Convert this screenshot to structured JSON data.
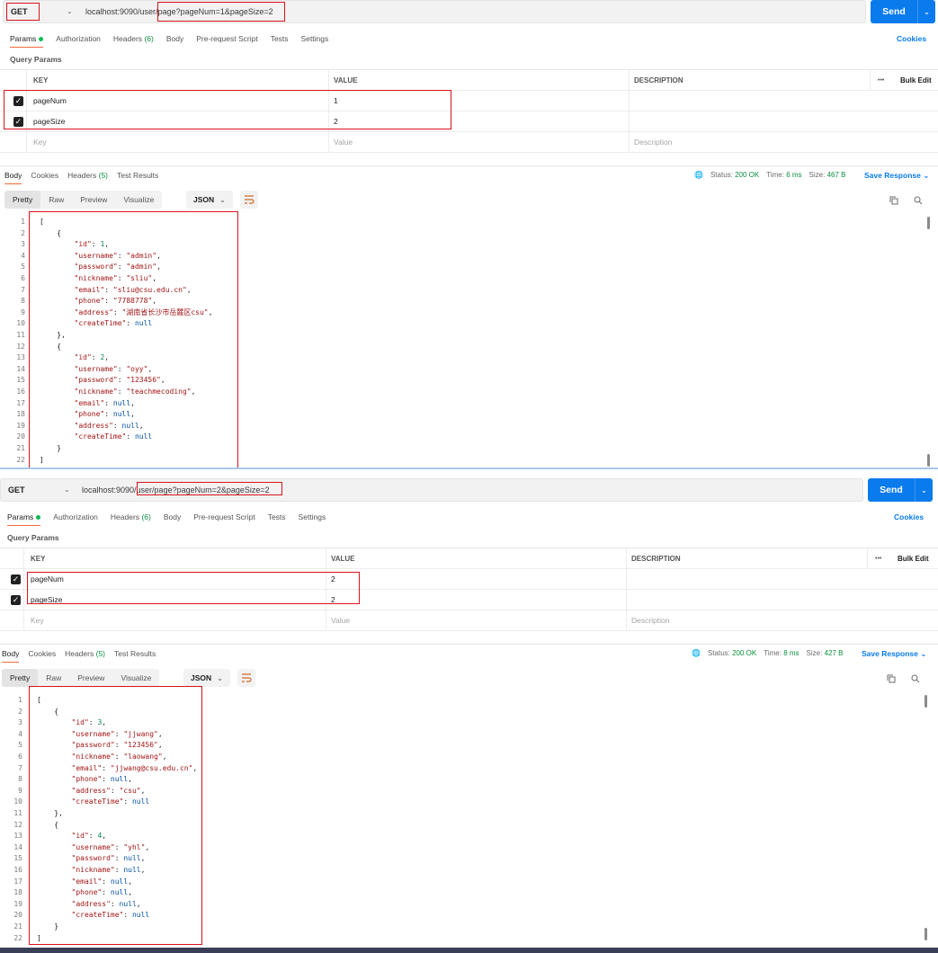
{
  "panels": [
    {
      "request": {
        "method": "GET",
        "url_prefix": "localhost:9090/user/",
        "url_suffix": "page?pageNum=1&pageSize=2",
        "send_label": "Send"
      },
      "tabs": {
        "params": "Params",
        "authorization": "Authorization",
        "headers": "Headers",
        "headers_count": "(6)",
        "body": "Body",
        "prerequest": "Pre-request Script",
        "tests": "Tests",
        "settings": "Settings",
        "cookies": "Cookies"
      },
      "query_params_label": "Query Params",
      "table": {
        "col_key": "KEY",
        "col_value": "VALUE",
        "col_description": "DESCRIPTION",
        "more": "•••",
        "bulk_edit": "Bulk Edit",
        "rows": [
          {
            "key": "pageNum",
            "value": "1"
          },
          {
            "key": "pageSize",
            "value": "2"
          }
        ],
        "placeholder_key": "Key",
        "placeholder_value": "Value",
        "placeholder_description": "Description"
      },
      "response": {
        "tabs": {
          "body": "Body",
          "cookies": "Cookies",
          "headers": "Headers",
          "headers_count": "(5)",
          "test_results": "Test Results"
        },
        "status_label": "Status:",
        "status_value": "200 OK",
        "time_label": "Time:",
        "time_value": "6 ms",
        "size_label": "Size:",
        "size_value": "467 B",
        "save_response": "Save Response",
        "formats": {
          "pretty": "Pretty",
          "raw": "Raw",
          "preview": "Preview",
          "visualize": "Visualize"
        },
        "json_label": "JSON"
      },
      "code_lines": [
        [
          [
            "p",
            "["
          ]
        ],
        [
          [
            "p",
            "    {"
          ]
        ],
        [
          [
            "p",
            "        "
          ],
          [
            "k",
            "\"id\""
          ],
          [
            "p",
            ": "
          ],
          [
            "n",
            "1"
          ],
          [
            "p",
            ","
          ]
        ],
        [
          [
            "p",
            "        "
          ],
          [
            "k",
            "\"username\""
          ],
          [
            "p",
            ": "
          ],
          [
            "s",
            "\"admin\""
          ],
          [
            "p",
            ","
          ]
        ],
        [
          [
            "p",
            "        "
          ],
          [
            "k",
            "\"password\""
          ],
          [
            "p",
            ": "
          ],
          [
            "s",
            "\"admin\""
          ],
          [
            "p",
            ","
          ]
        ],
        [
          [
            "p",
            "        "
          ],
          [
            "k",
            "\"nickname\""
          ],
          [
            "p",
            ": "
          ],
          [
            "s",
            "\"sliu\""
          ],
          [
            "p",
            ","
          ]
        ],
        [
          [
            "p",
            "        "
          ],
          [
            "k",
            "\"email\""
          ],
          [
            "p",
            ": "
          ],
          [
            "s",
            "\"sliu@csu.edu.cn\""
          ],
          [
            "p",
            ","
          ]
        ],
        [
          [
            "p",
            "        "
          ],
          [
            "k",
            "\"phone\""
          ],
          [
            "p",
            ": "
          ],
          [
            "s",
            "\"7788778\""
          ],
          [
            "p",
            ","
          ]
        ],
        [
          [
            "p",
            "        "
          ],
          [
            "k",
            "\"address\""
          ],
          [
            "p",
            ": "
          ],
          [
            "s",
            "\"湖南省长沙市岳麓区csu\""
          ],
          [
            "p",
            ","
          ]
        ],
        [
          [
            "p",
            "        "
          ],
          [
            "k",
            "\"createTime\""
          ],
          [
            "p",
            ": "
          ],
          [
            "nl",
            "null"
          ]
        ],
        [
          [
            "p",
            "    },"
          ]
        ],
        [
          [
            "p",
            "    {"
          ]
        ],
        [
          [
            "p",
            "        "
          ],
          [
            "k",
            "\"id\""
          ],
          [
            "p",
            ": "
          ],
          [
            "n",
            "2"
          ],
          [
            "p",
            ","
          ]
        ],
        [
          [
            "p",
            "        "
          ],
          [
            "k",
            "\"username\""
          ],
          [
            "p",
            ": "
          ],
          [
            "s",
            "\"oyy\""
          ],
          [
            "p",
            ","
          ]
        ],
        [
          [
            "p",
            "        "
          ],
          [
            "k",
            "\"password\""
          ],
          [
            "p",
            ": "
          ],
          [
            "s",
            "\"123456\""
          ],
          [
            "p",
            ","
          ]
        ],
        [
          [
            "p",
            "        "
          ],
          [
            "k",
            "\"nickname\""
          ],
          [
            "p",
            ": "
          ],
          [
            "s",
            "\"teachmecoding\""
          ],
          [
            "p",
            ","
          ]
        ],
        [
          [
            "p",
            "        "
          ],
          [
            "k",
            "\"email\""
          ],
          [
            "p",
            ": "
          ],
          [
            "nl",
            "null"
          ],
          [
            "p",
            ","
          ]
        ],
        [
          [
            "p",
            "        "
          ],
          [
            "k",
            "\"phone\""
          ],
          [
            "p",
            ": "
          ],
          [
            "nl",
            "null"
          ],
          [
            "p",
            ","
          ]
        ],
        [
          [
            "p",
            "        "
          ],
          [
            "k",
            "\"address\""
          ],
          [
            "p",
            ": "
          ],
          [
            "nl",
            "null"
          ],
          [
            "p",
            ","
          ]
        ],
        [
          [
            "p",
            "        "
          ],
          [
            "k",
            "\"createTime\""
          ],
          [
            "p",
            ": "
          ],
          [
            "nl",
            "null"
          ]
        ],
        [
          [
            "p",
            "    }"
          ]
        ],
        [
          [
            "p",
            "]"
          ]
        ]
      ]
    },
    {
      "request": {
        "method": "GET",
        "url_prefix": "localhost:9090/",
        "url_suffix": "user/page?pageNum=2&pageSize=2",
        "send_label": "Send"
      },
      "tabs": {
        "params": "Params",
        "authorization": "Authorization",
        "headers": "Headers",
        "headers_count": "(6)",
        "body": "Body",
        "prerequest": "Pre-request Script",
        "tests": "Tests",
        "settings": "Settings",
        "cookies": "Cookies"
      },
      "query_params_label": "Query Params",
      "table": {
        "col_key": "KEY",
        "col_value": "VALUE",
        "col_description": "DESCRIPTION",
        "more": "•••",
        "bulk_edit": "Bulk Edit",
        "rows": [
          {
            "key": "pageNum",
            "value": "2"
          },
          {
            "key": "pageSize",
            "value": "2"
          }
        ],
        "placeholder_key": "Key",
        "placeholder_value": "Value",
        "placeholder_description": "Description"
      },
      "response": {
        "tabs": {
          "body": "Body",
          "cookies": "Cookies",
          "headers": "Headers",
          "headers_count": "(5)",
          "test_results": "Test Results"
        },
        "status_label": "Status:",
        "status_value": "200 OK",
        "time_label": "Time:",
        "time_value": "8 ms",
        "size_label": "Size:",
        "size_value": "427 B",
        "save_response": "Save Response",
        "formats": {
          "pretty": "Pretty",
          "raw": "Raw",
          "preview": "Preview",
          "visualize": "Visualize"
        },
        "json_label": "JSON"
      },
      "code_lines": [
        [
          [
            "p",
            "["
          ]
        ],
        [
          [
            "p",
            "    {"
          ]
        ],
        [
          [
            "p",
            "        "
          ],
          [
            "k",
            "\"id\""
          ],
          [
            "p",
            ": "
          ],
          [
            "n",
            "3"
          ],
          [
            "p",
            ","
          ]
        ],
        [
          [
            "p",
            "        "
          ],
          [
            "k",
            "\"username\""
          ],
          [
            "p",
            ": "
          ],
          [
            "s",
            "\"jjwang\""
          ],
          [
            "p",
            ","
          ]
        ],
        [
          [
            "p",
            "        "
          ],
          [
            "k",
            "\"password\""
          ],
          [
            "p",
            ": "
          ],
          [
            "s",
            "\"123456\""
          ],
          [
            "p",
            ","
          ]
        ],
        [
          [
            "p",
            "        "
          ],
          [
            "k",
            "\"nickname\""
          ],
          [
            "p",
            ": "
          ],
          [
            "s",
            "\"laowang\""
          ],
          [
            "p",
            ","
          ]
        ],
        [
          [
            "p",
            "        "
          ],
          [
            "k",
            "\"email\""
          ],
          [
            "p",
            ": "
          ],
          [
            "s",
            "\"jjwang@csu.edu.cn\""
          ],
          [
            "p",
            ","
          ]
        ],
        [
          [
            "p",
            "        "
          ],
          [
            "k",
            "\"phone\""
          ],
          [
            "p",
            ": "
          ],
          [
            "nl",
            "null"
          ],
          [
            "p",
            ","
          ]
        ],
        [
          [
            "p",
            "        "
          ],
          [
            "k",
            "\"address\""
          ],
          [
            "p",
            ": "
          ],
          [
            "s",
            "\"csu\""
          ],
          [
            "p",
            ","
          ]
        ],
        [
          [
            "p",
            "        "
          ],
          [
            "k",
            "\"createTime\""
          ],
          [
            "p",
            ": "
          ],
          [
            "nl",
            "null"
          ]
        ],
        [
          [
            "p",
            "    },"
          ]
        ],
        [
          [
            "p",
            "    {"
          ]
        ],
        [
          [
            "p",
            "        "
          ],
          [
            "k",
            "\"id\""
          ],
          [
            "p",
            ": "
          ],
          [
            "n",
            "4"
          ],
          [
            "p",
            ","
          ]
        ],
        [
          [
            "p",
            "        "
          ],
          [
            "k",
            "\"username\""
          ],
          [
            "p",
            ": "
          ],
          [
            "s",
            "\"yhl\""
          ],
          [
            "p",
            ","
          ]
        ],
        [
          [
            "p",
            "        "
          ],
          [
            "k",
            "\"password\""
          ],
          [
            "p",
            ": "
          ],
          [
            "nl",
            "null"
          ],
          [
            "p",
            ","
          ]
        ],
        [
          [
            "p",
            "        "
          ],
          [
            "k",
            "\"nickname\""
          ],
          [
            "p",
            ": "
          ],
          [
            "nl",
            "null"
          ],
          [
            "p",
            ","
          ]
        ],
        [
          [
            "p",
            "        "
          ],
          [
            "k",
            "\"email\""
          ],
          [
            "p",
            ": "
          ],
          [
            "nl",
            "null"
          ],
          [
            "p",
            ","
          ]
        ],
        [
          [
            "p",
            "        "
          ],
          [
            "k",
            "\"phone\""
          ],
          [
            "p",
            ": "
          ],
          [
            "nl",
            "null"
          ],
          [
            "p",
            ","
          ]
        ],
        [
          [
            "p",
            "        "
          ],
          [
            "k",
            "\"address\""
          ],
          [
            "p",
            ": "
          ],
          [
            "nl",
            "null"
          ],
          [
            "p",
            ","
          ]
        ],
        [
          [
            "p",
            "        "
          ],
          [
            "k",
            "\"createTime\""
          ],
          [
            "p",
            ": "
          ],
          [
            "nl",
            "null"
          ]
        ],
        [
          [
            "p",
            "    }"
          ]
        ],
        [
          [
            "p",
            "]"
          ]
        ]
      ]
    }
  ]
}
